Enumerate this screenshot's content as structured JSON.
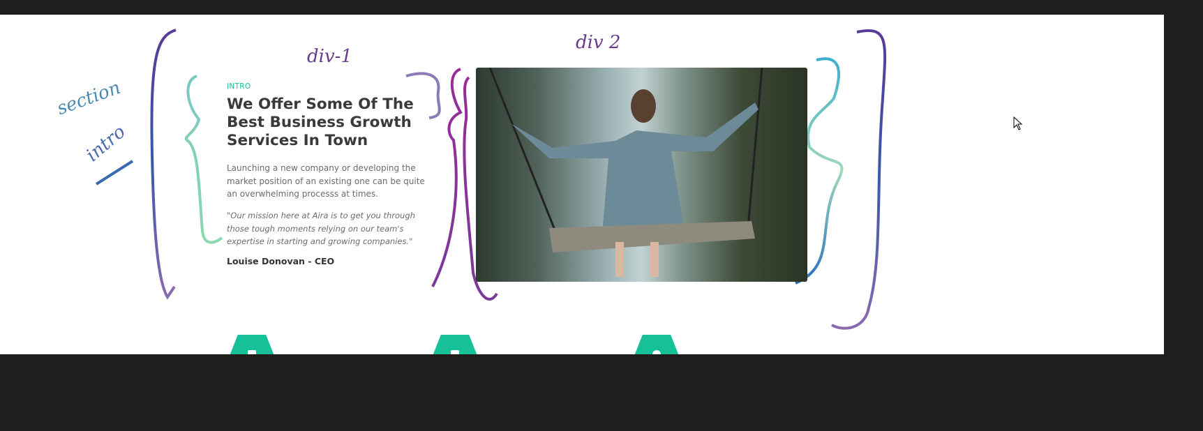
{
  "intro": {
    "label": "INTRO",
    "title": "We Offer Some Of The Best Business Growth Services In Town",
    "description": "Launching a new company or developing the market position of an existing one can be quite an overwhelming processs at times.",
    "quote": "\"Our mission here at Aira is to get you through those tough moments relying on our team's expertise in starting and growing companies.\"",
    "author": "Louise Donovan - CEO"
  },
  "annotations": {
    "section": "section",
    "intro": "intro",
    "div1": "div-1",
    "div2": "div 2"
  },
  "features": [
    {
      "icon": "team-icon"
    },
    {
      "icon": "calendar-icon"
    },
    {
      "icon": "pie-chart-icon"
    }
  ],
  "colors": {
    "accent": "#16c098",
    "heading": "#3a3a3a",
    "background": "#1f1e1d"
  }
}
